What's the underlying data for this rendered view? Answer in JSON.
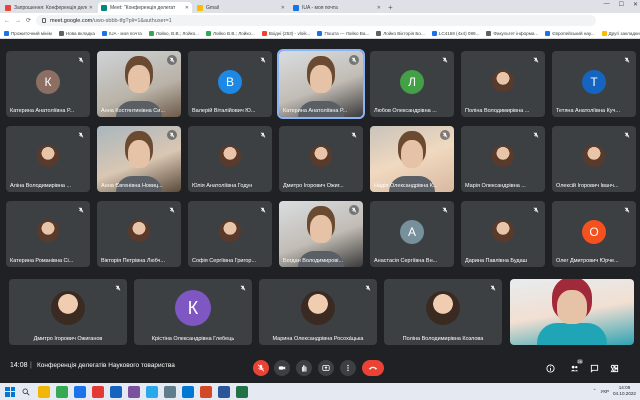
{
  "browser": {
    "tabs": [
      {
        "title": "Запрошення: Конференція делега",
        "color": "#ea4335"
      },
      {
        "title": "Meet: \"Конференція делегат",
        "color": "#00897b",
        "active": true
      },
      {
        "title": "Gmail",
        "color": "#fbbc04"
      },
      {
        "title": "IUA - моя почта",
        "color": "#1a73e8"
      }
    ],
    "new_tab": "+",
    "window_controls": {
      "minimize": "—",
      "maximize": "☐",
      "close": "✕"
    },
    "url": {
      "host": "meet.google.com",
      "path": "/uwo-sbbb-tfg?pli=1&authuser=1"
    },
    "nav": {
      "back": "←",
      "forward": "→",
      "reload": "⟳"
    },
    "bookmarks": [
      {
        "label": "Прожиточний мінім",
        "color": "#1a73e8"
      },
      {
        "label": "Нова вкладка",
        "color": "#5f6368"
      },
      {
        "label": "IUA - моя почта",
        "color": "#1a73e8"
      },
      {
        "label": "Лойко, В.В.; Лойко...",
        "color": "#34a853"
      },
      {
        "label": "Лойко В.В.; Лойко...",
        "color": "#34a853"
      },
      {
        "label": "Вхідні (253) - vloik...",
        "color": "#ea4335"
      },
      {
        "label": "Пошта — Лойко Ва...",
        "color": "#1a73e8"
      },
      {
        "label": "Лойко Вікторія Бо...",
        "color": "#5f6368"
      },
      {
        "label": "LC4168 (4x4) 089...",
        "color": "#1a73e8"
      },
      {
        "label": "Факультет інформа...",
        "color": "#5f6368"
      },
      {
        "label": "Європейський нау...",
        "color": "#1a73e8"
      },
      {
        "label": "Другі закладки",
        "color": "#fbbc04"
      }
    ]
  },
  "meet": {
    "participants": [
      {
        "name": "Катерина Анатоліївна Р...",
        "kind": "letter",
        "letter": "К",
        "color": "#8d6e63"
      },
      {
        "name": "Анна Костянтинівна Си...",
        "kind": "video",
        "video": "v1"
      },
      {
        "name": "Валерій Віталійович Ю...",
        "kind": "letter",
        "letter": "В",
        "color": "#1e88e5"
      },
      {
        "name": "Катерина Анатоліївна Р...",
        "kind": "video",
        "video": "v2",
        "speaking": true
      },
      {
        "name": "Любов Олександрівна ...",
        "kind": "letter",
        "letter": "Л",
        "color": "#43a047"
      },
      {
        "name": "Поліна Володимирівна ...",
        "kind": "photo"
      },
      {
        "name": "Тетяна Анатоліївна Куч...",
        "kind": "letter",
        "letter": "Т",
        "color": "#1565c0"
      },
      {
        "name": "Аліна Володимирівна ...",
        "kind": "photo"
      },
      {
        "name": "Анна Євгенівна Новиц...",
        "kind": "video",
        "video": "v3"
      },
      {
        "name": "Юлія Анатоліївна Годун",
        "kind": "photo"
      },
      {
        "name": "Дмитро Ігорович Ожиг...",
        "kind": "photo"
      },
      {
        "name": "Надія Олександрівна К...",
        "kind": "video",
        "video": "v4"
      },
      {
        "name": "Марія Олександрівна ...",
        "kind": "photo"
      },
      {
        "name": "Олексій Ігорович Іванч...",
        "kind": "photo"
      },
      {
        "name": "Катерина Романівна Сі...",
        "kind": "photo"
      },
      {
        "name": "Вікторія Петрівна Любч...",
        "kind": "photo"
      },
      {
        "name": "Софія Сергіївна Григор...",
        "kind": "photo"
      },
      {
        "name": "Богдан Володимирові...",
        "kind": "video",
        "video": "v2"
      },
      {
        "name": "Анастасія Сергіївна Вн...",
        "kind": "letter",
        "letter": "А",
        "color": "#78909c"
      },
      {
        "name": "Дарина Павлівна Будаш",
        "kind": "photo"
      },
      {
        "name": "Олег Дмитрович Юрче...",
        "kind": "letter",
        "letter": "О",
        "color": "#f4511e"
      }
    ],
    "bottom_row": [
      {
        "name": "Дмитро Ігорович Ожиганов",
        "kind": "photo"
      },
      {
        "name": "Крістіна Олександрівна Глебець",
        "kind": "letter",
        "letter": "К",
        "color": "#7e57c2"
      },
      {
        "name": "Марина Олександрівна Росоха́цька",
        "kind": "photo"
      },
      {
        "name": "Поліна Володимирівна Козлова",
        "kind": "photo"
      },
      {
        "name": "",
        "kind": "video",
        "video": "self"
      }
    ],
    "time": "14:08",
    "separator": "|",
    "title": "Конференція делегатів Наукового товариства",
    "participant_count": "26"
  },
  "taskbar": {
    "apps": [
      {
        "name": "file-explorer",
        "color": "#f2b705"
      },
      {
        "name": "chrome",
        "color": "#34a853"
      },
      {
        "name": "edge",
        "color": "#1a73e8"
      },
      {
        "name": "opera",
        "color": "#e53935"
      },
      {
        "name": "mail",
        "color": "#1565c0"
      },
      {
        "name": "viber",
        "color": "#7b519d"
      },
      {
        "name": "telegram",
        "color": "#29a9eb"
      },
      {
        "name": "calculator",
        "color": "#607d8b"
      },
      {
        "name": "outlook",
        "color": "#0078d4"
      },
      {
        "name": "powerpoint",
        "color": "#d24726"
      },
      {
        "name": "word",
        "color": "#2b579a"
      },
      {
        "name": "excel",
        "color": "#217346"
      }
    ],
    "lang": "УКР",
    "time": "14:08",
    "date": "04.10.2022"
  }
}
